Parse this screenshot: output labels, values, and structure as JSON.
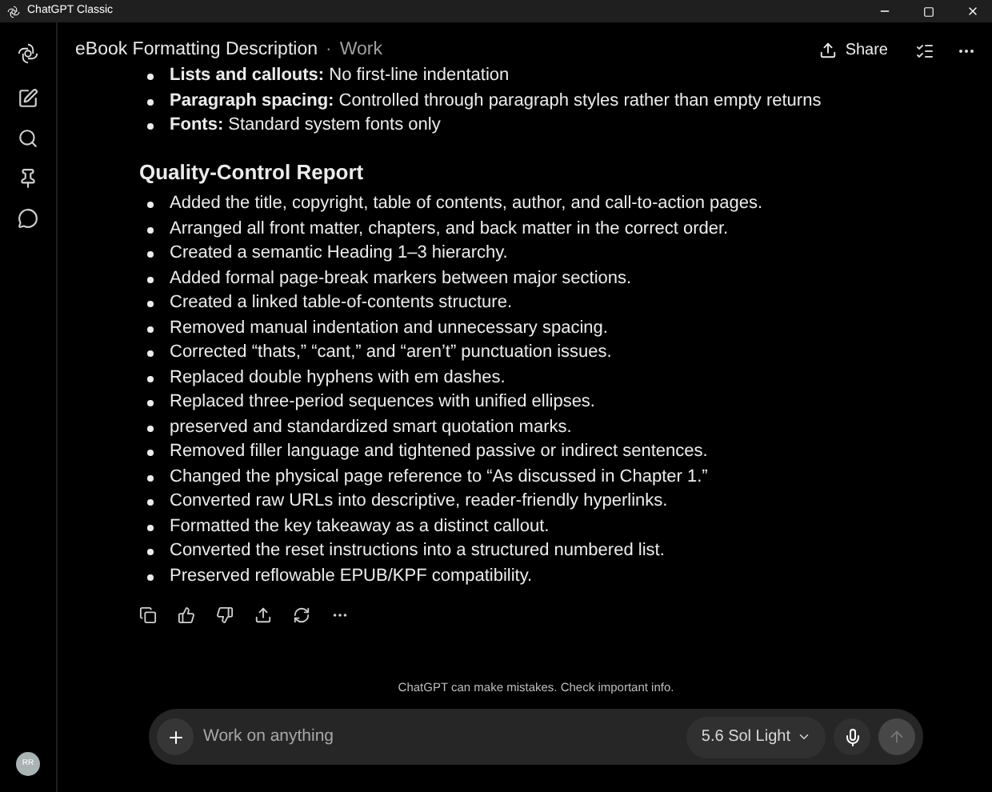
{
  "window": {
    "title": "ChatGPT Classic"
  },
  "header": {
    "title": "eBook Formatting Description",
    "separator": "·",
    "project": "Work",
    "share": "Share"
  },
  "avatar": {
    "initials": "RR"
  },
  "intro_items": [
    "**Lists and callouts:** No first-line indentation",
    "**Paragraph spacing:** Controlled through paragraph styles rather than empty returns",
    "**Fonts:** Standard system fonts only"
  ],
  "section": {
    "heading": "Quality-Control Report",
    "items": [
      "Added the title, copyright, table of contents, author, and call-to-action pages.",
      "Arranged all front matter, chapters, and back matter in the correct order.",
      "Created a semantic Heading 1–3 hierarchy.",
      "Added formal page-break markers between major sections.",
      "Created a linked table-of-contents structure.",
      "Removed manual indentation and unnecessary spacing.",
      "Corrected “thats,” “cant,” and “aren’t” punctuation issues.",
      "Replaced double hyphens with em dashes.",
      "Replaced three-period sequences with unified ellipses.",
      "preserved and standardized smart quotation marks.",
      "Removed filler language and tightened passive or indirect sentences.",
      "Changed the physical page reference to “As discussed in Chapter 1.”",
      "Converted raw URLs into descriptive, reader-friendly hyperlinks.",
      "Formatted the key takeaway as a distinct callout.",
      "Converted the reset instructions into a structured numbered list.",
      "Preserved reflowable EPUB/KPF compatibility."
    ]
  },
  "disclaimer": "ChatGPT can make mistakes. Check important info.",
  "composer": {
    "placeholder": "Work on anything",
    "model": "5.6 Sol Light"
  }
}
